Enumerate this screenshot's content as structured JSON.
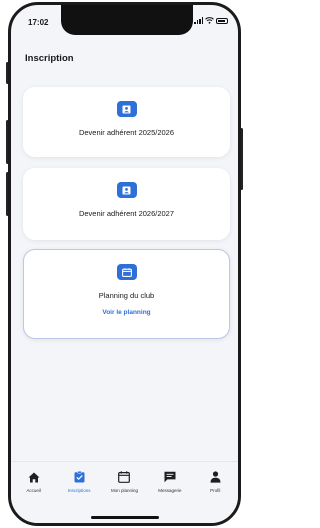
{
  "status_bar": {
    "time": "17:02"
  },
  "header": {
    "title": "Inscription"
  },
  "cards": [
    {
      "label": "Devenir adhérent 2025/2026",
      "icon": "id-badge-icon"
    },
    {
      "label": "Devenir adhérent 2026/2027",
      "icon": "id-badge-icon"
    },
    {
      "label": "Planning du club",
      "link": "Voir le planning",
      "icon": "calendar-icon"
    }
  ],
  "tabbar": {
    "items": [
      {
        "label": "Accueil",
        "icon": "home-icon",
        "active": false
      },
      {
        "label": "Inscriptions",
        "icon": "clipboard-check-icon",
        "active": true
      },
      {
        "label": "Mon planning",
        "icon": "calendar-icon",
        "active": false
      },
      {
        "label": "Messagerie",
        "icon": "chat-icon",
        "active": false
      },
      {
        "label": "Profil",
        "icon": "person-icon",
        "active": false
      }
    ]
  },
  "colors": {
    "accent": "#2f6fd8",
    "background": "#f3f5f9",
    "card": "#ffffff"
  }
}
